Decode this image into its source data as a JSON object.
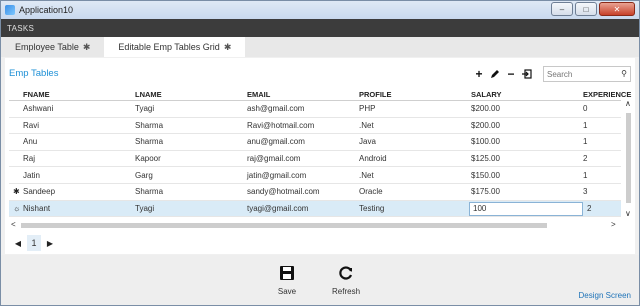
{
  "window": {
    "title": "Application10"
  },
  "tasks_label": "TASKS",
  "tabs": [
    {
      "label": "Employee Table",
      "star": "✱"
    },
    {
      "label": "Editable Emp Tables Grid",
      "star": "✱"
    }
  ],
  "section_title": "Emp Tables",
  "search": {
    "placeholder": "Search"
  },
  "grid": {
    "columns": [
      "FNAME",
      "LNAME",
      "EMAIL",
      "PROFILE",
      "SALARY",
      "EXPERIENCE"
    ],
    "rows": [
      {
        "marker": "",
        "fname": "Ashwani",
        "lname": "Tyagi",
        "email": "ash@gmail.com",
        "profile": "PHP",
        "salary": "$200.00",
        "experience": "0"
      },
      {
        "marker": "",
        "fname": "Ravi",
        "lname": "Sharma",
        "email": "Ravi@hotmail.com",
        "profile": ".Net",
        "salary": "$200.00",
        "experience": "1"
      },
      {
        "marker": "",
        "fname": "Anu",
        "lname": "Sharma",
        "email": "anu@gmail.com",
        "profile": "Java",
        "salary": "$100.00",
        "experience": "1"
      },
      {
        "marker": "",
        "fname": "Raj",
        "lname": "Kapoor",
        "email": "raj@gmail.com",
        "profile": "Android",
        "salary": "$125.00",
        "experience": "2"
      },
      {
        "marker": "",
        "fname": "Jatin",
        "lname": "Garg",
        "email": "jatin@gmail.com",
        "profile": ".Net",
        "salary": "$150.00",
        "experience": "1"
      },
      {
        "marker": "✱",
        "fname": "Sandeep",
        "lname": "Sharma",
        "email": "sandy@hotmail.com",
        "profile": "Oracle",
        "salary": "$175.00",
        "experience": "3"
      },
      {
        "marker": "☼",
        "fname": "Nishant",
        "lname": "Tyagi",
        "email": "tyagi@gmail.com",
        "profile": "Testing",
        "salary": "100",
        "experience": "2"
      }
    ]
  },
  "pager": {
    "current_page": "1"
  },
  "commands": {
    "save": "Save",
    "refresh": "Refresh"
  },
  "design_link": "Design Screen",
  "colors": {
    "accent": "#1e90d6",
    "tasks_bar": "#3c3c3c",
    "selected_row": "#d9ebf7"
  }
}
